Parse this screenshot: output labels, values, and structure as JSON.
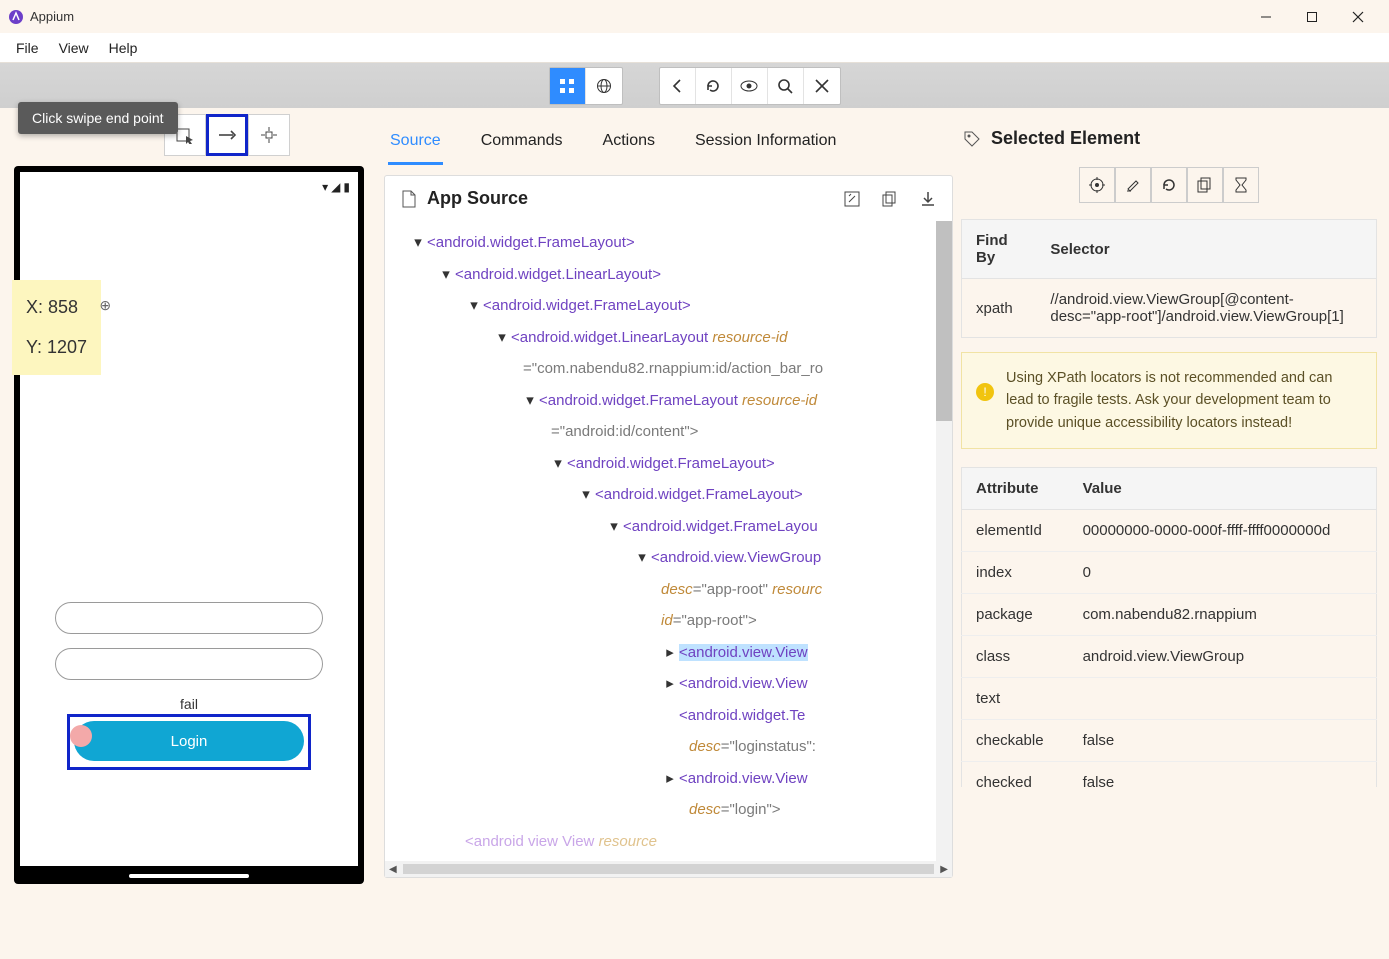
{
  "window": {
    "title": "Appium"
  },
  "menus": {
    "file": "File",
    "edit": "View",
    "help": "Help"
  },
  "tooltip": "Click swipe end point",
  "coords": {
    "x": "X: 858",
    "y": "Y: 1207"
  },
  "device": {
    "fail_label": "fail",
    "login_label": "Login"
  },
  "mid_tabs": {
    "source": "Source",
    "commands": "Commands",
    "actions": "Actions",
    "session": "Session Information"
  },
  "source": {
    "title": "App Source",
    "tree": {
      "n1": "<android.widget.FrameLayout>",
      "n2": "<android.widget.LinearLayout>",
      "n3": "<android.widget.FrameLayout>",
      "n4_a": "<android.widget.LinearLayout ",
      "n4_b": "resource-id",
      "n4_c": "=\"com.nabendu82.rnappium:id/action_bar_ro",
      "n5_a": "<android.widget.FrameLayout ",
      "n5_b": "resource-id",
      "n5_c": "=\"android:id/content\">",
      "n6": "<android.widget.FrameLayout>",
      "n7": "<android.widget.FrameLayout>",
      "n8": "<android.widget.FrameLayou",
      "n9_a": "<android.view.ViewGroup",
      "n9_b": "desc",
      "n9_c": "=\"app-root\" ",
      "n9_d": "resourc",
      "n9_e": "id",
      "n9_f": "=\"app-root\">",
      "n10": "<android.view.View",
      "n11": "<android.view.View",
      "n12_a": "<android.widget.Te",
      "n12_b": "desc",
      "n12_c": "=\"loginstatus\":",
      "n13_a": "<android.view.View",
      "n13_b": "desc",
      "n13_c": "=\"login\">",
      "n14_a": "<android view View ",
      "n14_b": "resource"
    }
  },
  "selected": {
    "title": "Selected Element",
    "findby_hdr": "Find By",
    "selector_hdr": "Selector",
    "findby_val": "xpath",
    "selector_val": "//android.view.ViewGroup[@content-desc=\"app-root\"]/android.view.ViewGroup[1]",
    "warn": "Using XPath locators is not recommended and can lead to fragile tests. Ask your development team to provide unique accessibility locators instead!",
    "attr_hdr": "Attribute",
    "val_hdr": "Value",
    "rows": {
      "elementId_k": "elementId",
      "elementId_v": "00000000-0000-000f-ffff-ffff0000000d",
      "index_k": "index",
      "index_v": "0",
      "package_k": "package",
      "package_v": "com.nabendu82.rnappium",
      "class_k": "class",
      "class_v": "android.view.ViewGroup",
      "text_k": "text",
      "text_v": "",
      "checkable_k": "checkable",
      "checkable_v": "false",
      "checked_k": "checked",
      "checked_v": "false"
    }
  }
}
